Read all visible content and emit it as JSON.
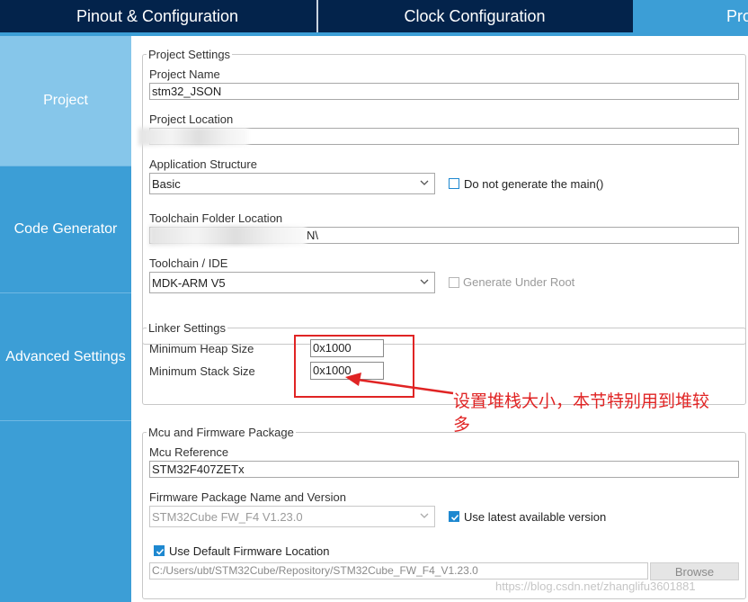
{
  "tabs": {
    "pinout": "Pinout & Configuration",
    "clock": "Clock Configuration",
    "project_manager": "Proj"
  },
  "sidebar": {
    "items": [
      {
        "label": "Project"
      },
      {
        "label": "Code Generator"
      },
      {
        "label": "Advanced Settings"
      }
    ]
  },
  "project_settings": {
    "legend": "Project Settings",
    "project_name_label": "Project Name",
    "project_name_value": "stm32_JSON",
    "project_location_label": "Project Location",
    "project_location_value": "",
    "app_structure_label": "Application Structure",
    "app_structure_value": "Basic",
    "do_not_generate_main": "Do not generate the main()",
    "toolchain_folder_label": "Toolchain Folder Location",
    "toolchain_folder_value": "N\\",
    "toolchain_ide_label": "Toolchain / IDE",
    "toolchain_ide_value": "MDK-ARM V5",
    "generate_under_root": "Generate Under Root"
  },
  "linker_settings": {
    "legend": "Linker Settings",
    "heap_label": "Minimum Heap Size",
    "heap_value": "0x1000",
    "stack_label": "Minimum Stack Size",
    "stack_value": "0x1000"
  },
  "annotation": {
    "line1": "设置堆栈大小，本节特别用到堆较",
    "line2": "多",
    "color": "#e02424"
  },
  "mcu_firmware": {
    "legend": "Mcu and Firmware Package",
    "mcu_reference_label": "Mcu Reference",
    "mcu_reference_value": "STM32F407ZETx",
    "firmware_name_label": "Firmware Package Name and Version",
    "firmware_name_value": "STM32Cube FW_F4 V1.23.0",
    "use_latest": "Use latest available version",
    "use_default_location": "Use Default Firmware Location",
    "firmware_path": "C:/Users/ubt/STM32Cube/Repository/STM32Cube_FW_F4_V1.23.0",
    "browse": "Browse"
  },
  "watermark": "https://blog.csdn.net/zhanglifu3601881",
  "colors": {
    "header_bg": "#03234b",
    "accent": "#3c9ed6",
    "sidebar_selected": "#86c6ea",
    "checkbox": "#1e88d0"
  }
}
